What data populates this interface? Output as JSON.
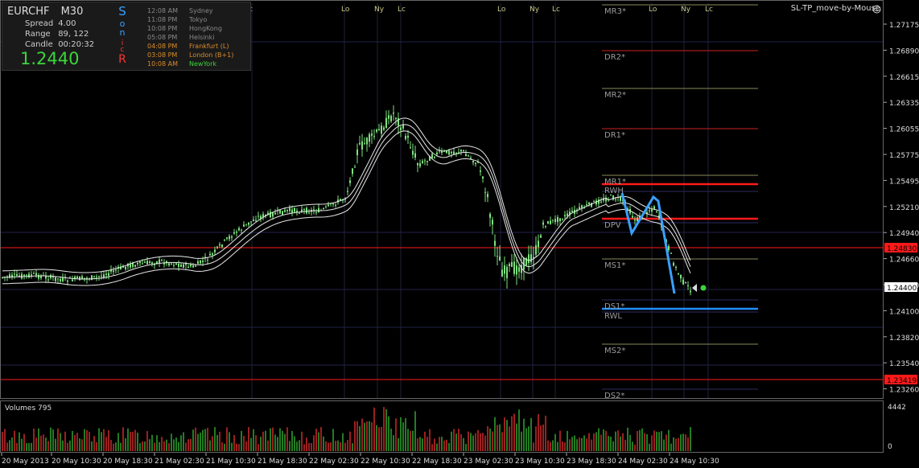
{
  "info": {
    "symbol": "EURCHF",
    "timeframe": "M30",
    "spread_label": "Spread",
    "spread_value": "4.00",
    "range_label": "Range",
    "range_value": "89, 122",
    "candle_label": "Candle",
    "candle_value": "00:20:32",
    "price": "1.2440",
    "son_letters": [
      "S",
      "o",
      "n",
      "i",
      "c",
      "R"
    ]
  },
  "sessions": [
    {
      "time": "12:08 AM",
      "city": "Sydney"
    },
    {
      "time": "11:08 PM",
      "city": "Tokyo"
    },
    {
      "time": "10:08 PM",
      "city": "HongKong"
    },
    {
      "time": "05:08 PM",
      "city": "Helsinki"
    },
    {
      "time": "04:08 PM",
      "city": "Frankfurt  (L)"
    },
    {
      "time": "03:08 PM",
      "city": "London  (B+1)"
    },
    {
      "time": "10:08 AM",
      "city": "NewYork"
    }
  ],
  "chart_title": "SL-TP_move-by-Mouse",
  "volume_label": "Volumes 795",
  "volume_scale": [
    "4442",
    "0"
  ],
  "price_axis": [
    "1.27175",
    "1.26890",
    "1.26615",
    "1.26335",
    "1.26055",
    "1.25775",
    "1.25495",
    "1.25210",
    "1.24940",
    "1.24660",
    "1.24400",
    "1.24100",
    "1.23820",
    "1.23540",
    "1.23260"
  ],
  "price_tags": {
    "upper_red": "1.24830",
    "lower_red": "1.23419",
    "current": "1.24400"
  },
  "time_axis": [
    "20 May 2013",
    "20 May 10:30",
    "20 May 18:30",
    "21 May 02:30",
    "21 May 10:30",
    "21 May 18:30",
    "22 May 02:30",
    "22 May 10:30",
    "22 May 18:30",
    "23 May 02:30",
    "23 May 10:30",
    "23 May 18:30",
    "24 May 02:30",
    "24 May 10:30"
  ],
  "session_markers": [
    "c",
    "Lo",
    "Ny",
    "Lc",
    "Lo",
    "Ny",
    "Lc",
    "Lo",
    "Ny",
    "Lc"
  ],
  "pivot_labels": [
    "MR3*",
    "DR2*",
    "MR2*",
    "DR1*",
    "MR1*",
    "RWH",
    "DPV",
    "MS1*",
    "DS1*",
    "RWL",
    "MS2*",
    "DS2*"
  ],
  "colors": {
    "background": "#000000",
    "candle": "#7ee27e",
    "red_line": "#ff1a1a",
    "blue_line": "#1e90ff",
    "zigzag": "#3aa0ff",
    "volume": "#b82020",
    "grid": "#2b2b50"
  }
}
